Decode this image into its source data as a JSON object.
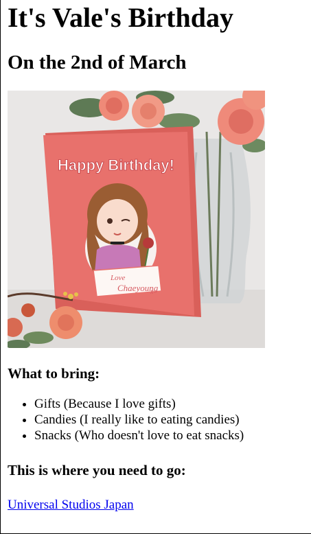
{
  "page": {
    "title": "It's Vale's Birthday",
    "subtitle": "On the 2nd of March"
  },
  "card_image": {
    "card_heading": "Happy Birthday!",
    "card_tag": "Love Chaeyoung x",
    "colors": {
      "card": "#e8716c",
      "background": "#e9e7e6",
      "rose": "#f08a7a"
    }
  },
  "bring": {
    "heading": "What to bring:",
    "items": [
      "Gifts (Because I love gifts)",
      "Candies (I really like to eating candies)",
      "Snacks (Who doesn't love to eat snacks)"
    ]
  },
  "where": {
    "heading": "This is where you need to go:",
    "link_text": "Universal Studios Japan",
    "link_color": "#0000ee"
  }
}
